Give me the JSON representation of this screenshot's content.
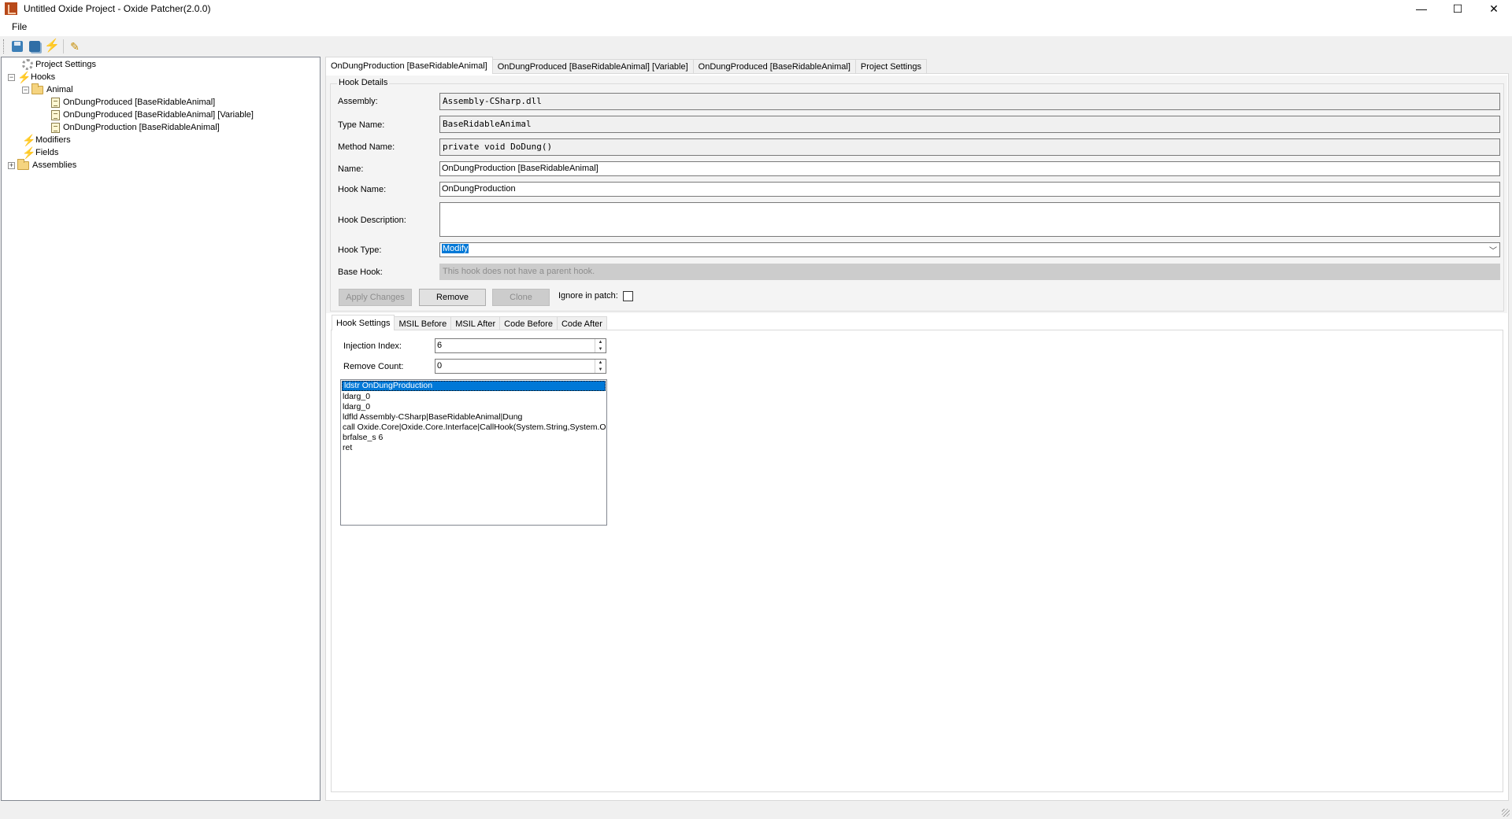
{
  "window": {
    "title": "Untitled Oxide Project - Oxide Patcher(2.0.0)",
    "controls": [
      "—",
      "☐",
      "✕"
    ]
  },
  "menu": {
    "file": "File"
  },
  "toolbar": {
    "icons": [
      "save-icon",
      "save-as-icon",
      "hook-icon",
      "wand-icon"
    ]
  },
  "tree": {
    "project_settings": "Project Settings",
    "hooks": "Hooks",
    "animal": "Animal",
    "hook_items": [
      "OnDungProduced [BaseRidableAnimal]",
      "OnDungProduced [BaseRidableAnimal] [Variable]",
      "OnDungProduction [BaseRidableAnimal]"
    ],
    "modifiers": "Modifiers",
    "fields": "Fields",
    "assemblies": "Assemblies"
  },
  "tabs": [
    "OnDungProduction [BaseRidableAnimal]",
    "OnDungProduced [BaseRidableAnimal] [Variable]",
    "OnDungProduced [BaseRidableAnimal]",
    "Project Settings"
  ],
  "hook_details": {
    "group_title": "Hook Details",
    "assembly_label": "Assembly:",
    "assembly": "Assembly-CSharp.dll",
    "type_name_label": "Type Name:",
    "type_name": "BaseRidableAnimal",
    "method_name_label": "Method Name:",
    "method_name": "private void DoDung()",
    "name_label": "Name:",
    "name": "OnDungProduction [BaseRidableAnimal]",
    "hook_name_label": "Hook Name:",
    "hook_name": "OnDungProduction",
    "hook_description_label": "Hook Description:",
    "hook_description": "",
    "hook_type_label": "Hook Type:",
    "hook_type": "Modify",
    "base_hook_label": "Base Hook:",
    "base_hook_placeholder": "This hook does not have a parent hook.",
    "apply_changes": "Apply Changes",
    "remove": "Remove",
    "clone": "Clone",
    "ignore_in_patch": "Ignore in patch:"
  },
  "sub_tabs": [
    "Hook Settings",
    "MSIL Before",
    "MSIL After",
    "Code Before",
    "Code After"
  ],
  "hook_settings": {
    "injection_index_label": "Injection Index:",
    "injection_index": "6",
    "remove_count_label": "Remove Count:",
    "remove_count": "0",
    "instructions": [
      "ldstr OnDungProduction",
      "ldarg_0",
      "ldarg_0",
      "ldfld Assembly-CSharp|BaseRidableAnimal|Dung",
      "call Oxide.Core|Oxide.Core.Interface|CallHook(System.String,System.Object)",
      "brfalse_s 6",
      "ret"
    ]
  }
}
